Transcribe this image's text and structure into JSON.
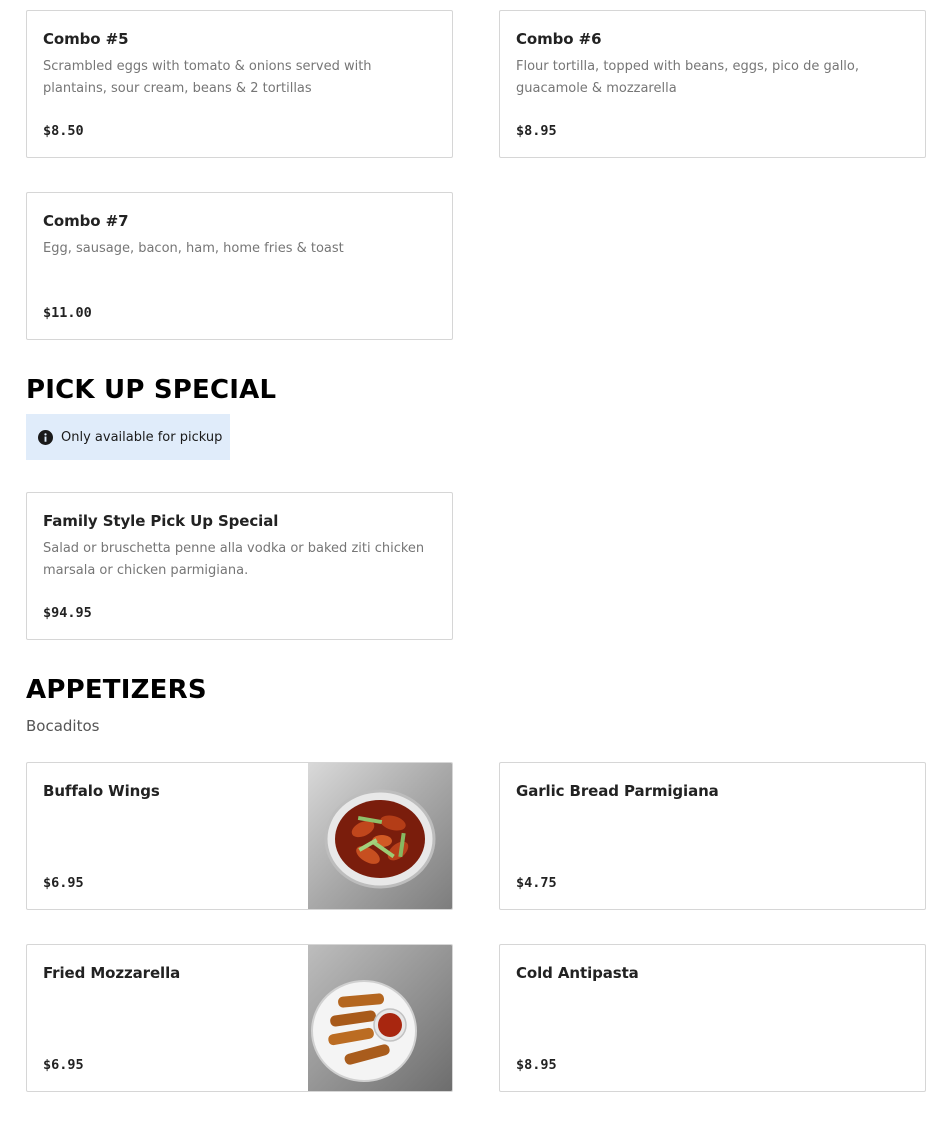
{
  "breakfast": {
    "items": [
      {
        "name": "Combo #5",
        "description": "Scrambled eggs with tomato & onions served with plantains, sour cream, beans & 2 tortillas",
        "price": "$8.50"
      },
      {
        "name": "Combo #6",
        "description": "Flour tortilla, topped with beans, eggs, pico de gallo, guacamole & mozzarella",
        "price": "$8.95"
      },
      {
        "name": "Combo #7",
        "description": "Egg, sausage, bacon, ham, home fries & toast",
        "price": "$11.00"
      }
    ]
  },
  "pickup_special": {
    "title": "PICK UP SPECIAL",
    "notice": "Only available for pickup",
    "notice_icon": "info-icon",
    "items": [
      {
        "name": "Family Style Pick Up Special",
        "description": "Salad or bruschetta penne alla vodka or baked ziti chicken marsala or chicken parmigiana.",
        "price": "$94.95"
      }
    ]
  },
  "appetizers": {
    "title": "APPETIZERS",
    "subtitle": "Bocaditos",
    "items": [
      {
        "name": "Buffalo Wings",
        "price": "$6.95",
        "image": "buffalo-wings-photo"
      },
      {
        "name": "Garlic Bread Parmigiana",
        "price": "$4.75"
      },
      {
        "name": "Fried Mozzarella",
        "price": "$6.95",
        "image": "fried-mozzarella-photo"
      },
      {
        "name": "Cold Antipasta",
        "price": "$8.95"
      }
    ]
  }
}
